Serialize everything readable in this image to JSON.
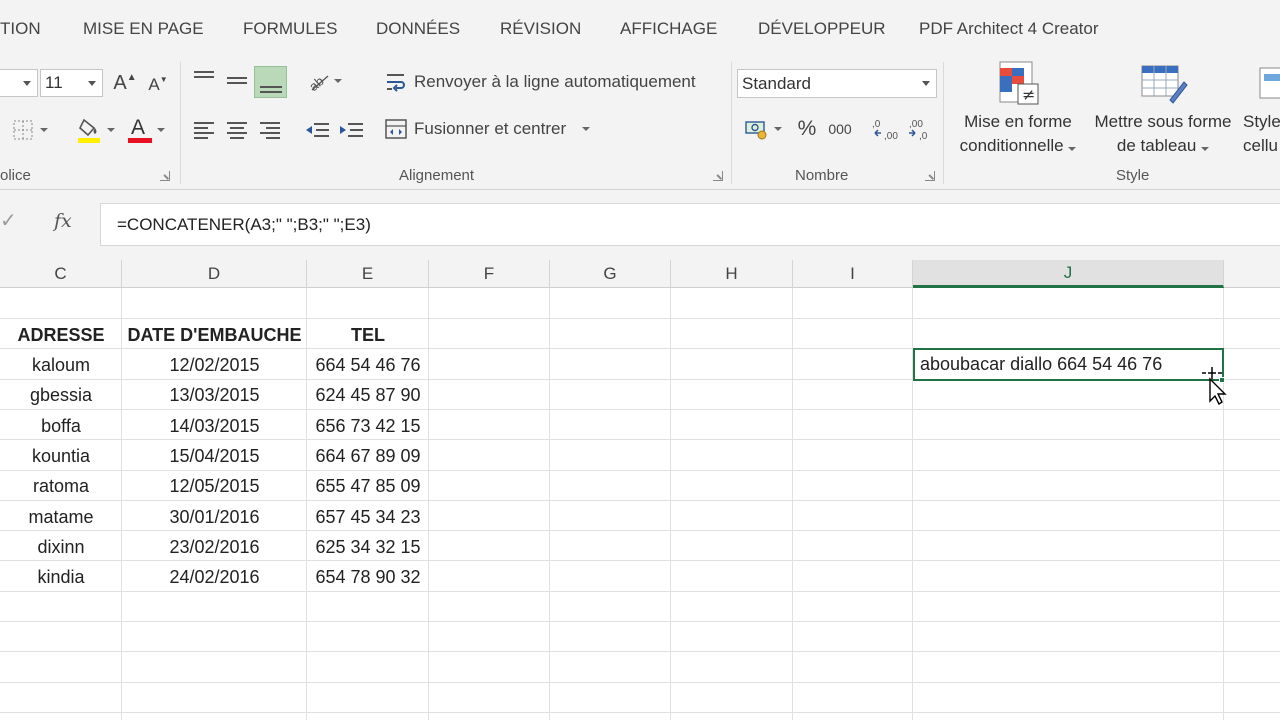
{
  "ribbon_tabs": [
    "TION",
    "MISE EN PAGE",
    "FORMULES",
    "DONNÉES",
    "RÉVISION",
    "AFFICHAGE",
    "DÉVELOPPEUR",
    "PDF Architect 4 Creator"
  ],
  "font_group": {
    "label": "olice",
    "font_size": "11",
    "grow_font": "A",
    "shrink_font": "A",
    "font_color_letter": "A"
  },
  "alignment_group": {
    "label": "Alignement",
    "wrap_text": "Renvoyer à la ligne automatiquement",
    "merge_center": "Fusionner et centrer"
  },
  "number_group": {
    "label": "Nombre",
    "format": "Standard",
    "percent": "%",
    "thousands": "000"
  },
  "style_group": {
    "label": "Style",
    "conditional_line1": "Mise en forme",
    "conditional_line2": "conditionnelle",
    "table_line1": "Mettre sous forme",
    "table_line2": "de tableau",
    "cell_styles_line1": "Style",
    "cell_styles_line2": "cellu"
  },
  "formula_bar": {
    "fx": "fx",
    "formula": "=CONCATENER(A3;\" \";B3;\" \";E3)"
  },
  "colors": {
    "accent": "#217346",
    "font_color": "#e81123",
    "fill_color": "#ffee00"
  },
  "columns": [
    "C",
    "D",
    "E",
    "F",
    "G",
    "H",
    "I",
    "J"
  ],
  "active_column": "J",
  "table": {
    "headers": [
      "ADRESSE",
      "DATE D'EMBAUCHE",
      "TEL"
    ],
    "rows": [
      [
        "kaloum",
        "12/02/2015",
        "664 54 46 76"
      ],
      [
        "gbessia",
        "13/03/2015",
        "624 45 87 90"
      ],
      [
        "boffa",
        "14/03/2015",
        "656 73 42 15"
      ],
      [
        "kountia",
        "15/04/2015",
        "664 67 89 09"
      ],
      [
        "ratoma",
        "12/05/2015",
        "655 47 85 09"
      ],
      [
        "matame",
        "30/01/2016",
        "657 45 34 23"
      ],
      [
        "dixinn",
        "23/02/2016",
        "625 34 32 15"
      ],
      [
        "kindia",
        "24/02/2016",
        "654 78 90 32"
      ]
    ]
  },
  "selected_cell_value": "aboubacar diallo 664 54 46 76"
}
